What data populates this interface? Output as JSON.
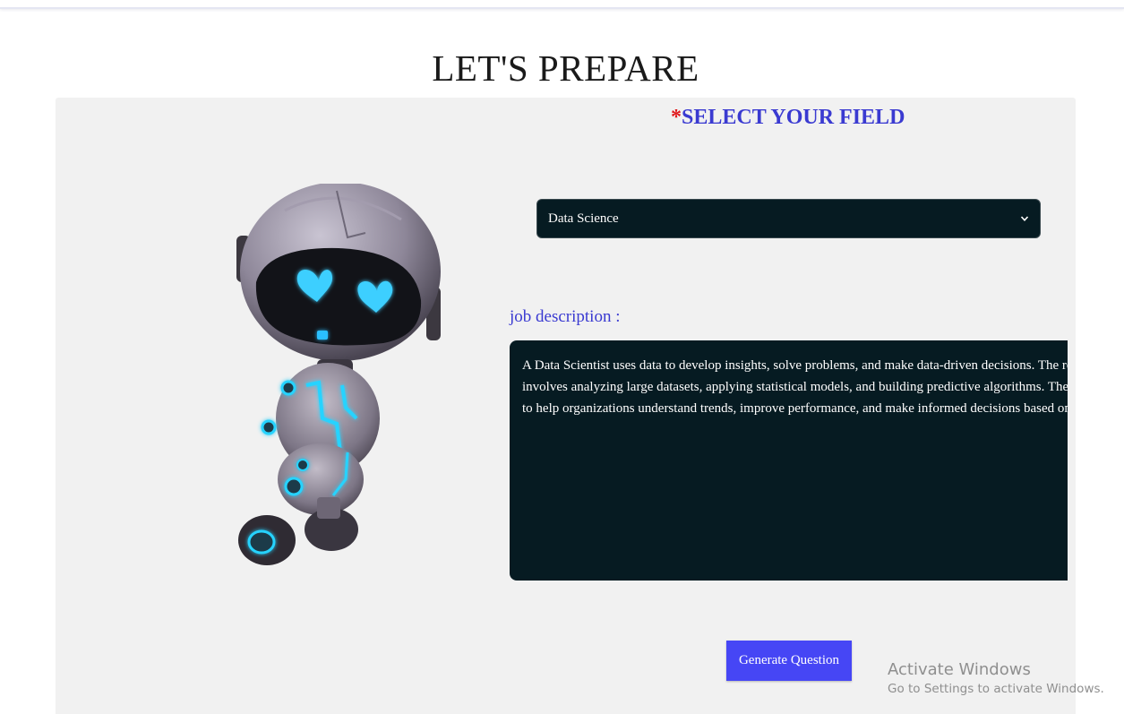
{
  "page": {
    "title": "LET'S PREPARE"
  },
  "form": {
    "required_marker": "*",
    "field_heading": "SELECT YOUR FIELD",
    "field_select": {
      "selected": "Data Science"
    },
    "job_description_label": "job description :",
    "job_description_text": "A Data Scientist uses data to develop insights, solve problems, and make data-driven decisions. The role involves analyzing large datasets, applying statistical models, and building predictive algorithms. The goal is to help organizations understand trends, improve performance, and make informed decisions based on data.",
    "generate_button_label": "Generate Question"
  },
  "illustration": {
    "icon": "robot-mascot-icon"
  },
  "watermark": {
    "title": "Activate Windows",
    "subtitle": "Go to Settings to activate Windows."
  },
  "colors": {
    "accent": "#3a3ad1",
    "button": "#4646f5",
    "required": "#e0171b",
    "dark_field": "#061b22",
    "panel": "#f1f1f1",
    "robot_glow": "#27d3ff"
  }
}
